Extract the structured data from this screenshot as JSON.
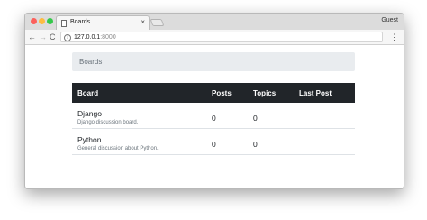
{
  "browser": {
    "tab_title": "Boards",
    "tab_close": "×",
    "profile": "Guest",
    "url_host": "127.0.0.1",
    "url_port": ":8000",
    "nav_back": "←",
    "nav_forward": "→",
    "nav_reload": "C",
    "menu": "⋮",
    "info_glyph": "i"
  },
  "page": {
    "breadcrumb": "Boards",
    "table": {
      "headers": [
        "Board",
        "Posts",
        "Topics",
        "Last Post"
      ],
      "rows": [
        {
          "name": "Django",
          "description": "Django discussion board.",
          "posts": "0",
          "topics": "0",
          "last_post": ""
        },
        {
          "name": "Python",
          "description": "General discussion about Python.",
          "posts": "0",
          "topics": "0",
          "last_post": ""
        }
      ]
    }
  },
  "colors": {
    "window_close": "#fc605b",
    "window_minimize": "#fdbc40",
    "window_zoom": "#34c84a",
    "table_header_bg": "#212529",
    "breadcrumb_bg": "#e9ecef"
  }
}
